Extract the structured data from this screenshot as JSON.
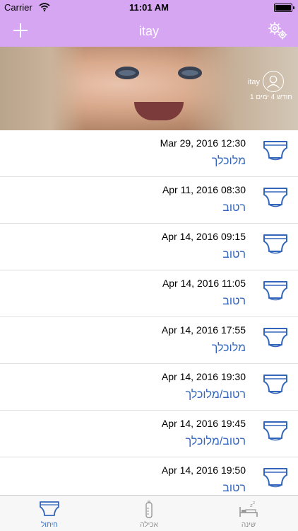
{
  "status_bar": {
    "carrier": "Carrier",
    "time": "11:01 AM"
  },
  "nav": {
    "title": "itay",
    "add_icon": "plus-icon",
    "settings_icon": "gears-icon"
  },
  "profile": {
    "name": "itay",
    "age": "1 חודש 4 ימים"
  },
  "colors": {
    "accent_purple": "#d7a6f3",
    "link_blue": "#3366bb"
  },
  "entries": [
    {
      "date": "Mar 29, 2016 12:30",
      "type": "מלוכלך"
    },
    {
      "date": "Apr 11, 2016 08:30",
      "type": "רטוב"
    },
    {
      "date": "Apr 14, 2016 09:15",
      "type": "רטוב"
    },
    {
      "date": "Apr 14, 2016 11:05",
      "type": "רטוב"
    },
    {
      "date": "Apr 14, 2016 17:55",
      "type": "מלוכלך"
    },
    {
      "date": "Apr 14, 2016 19:30",
      "type": "רטוב/מלוכלך"
    },
    {
      "date": "Apr 14, 2016 19:45",
      "type": "רטוב/מלוכלך"
    },
    {
      "date": "Apr 14, 2016 19:50",
      "type": "רטוב"
    }
  ],
  "tabs": [
    {
      "label": "חיתול",
      "icon": "diaper-icon",
      "active": true
    },
    {
      "label": "אכילה",
      "icon": "bottle-icon",
      "active": false
    },
    {
      "label": "שינה",
      "icon": "bed-icon",
      "active": false
    }
  ]
}
